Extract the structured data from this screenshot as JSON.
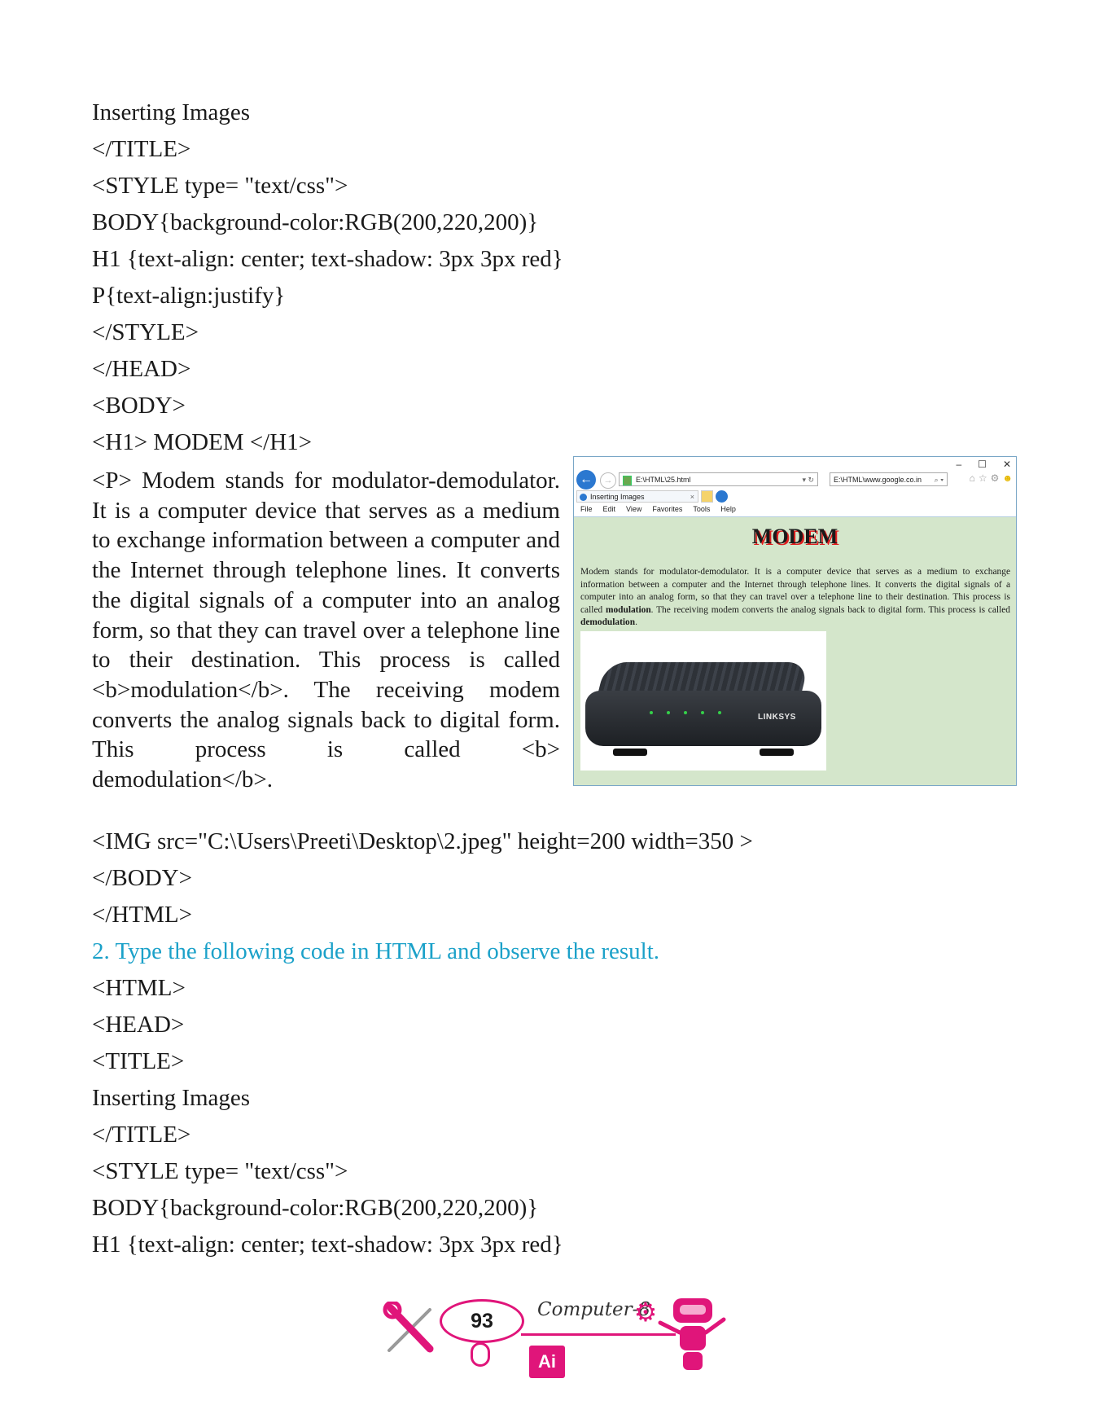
{
  "code_top": [
    "Inserting Images",
    "</TITLE>",
    "<STYLE type= \"text/css\">",
    "BODY{background-color:RGB(200,220,200)}",
    "H1 {text-align: center; text-shadow: 3px 3px red}",
    "P{text-align:justify}",
    "</STYLE>",
    "</HEAD>",
    "<BODY>",
    "<H1> MODEM </H1>"
  ],
  "code_paragraph": "<P> Modem stands for modulator-demodulator. It is a computer device that serves as a medium to exchange information between a computer and the Internet through telephone lines. It converts the digital signals of a computer into an analog form, so that they can travel over a telephone line to their destination. This process is called <b>modulation</b>. The receiving modem converts the analog signals back to digital form. This process is called <b>",
  "code_paragraph_end": "demodulation</b>.",
  "code_bottom": [
    "<IMG src=\"C:\\Users\\Preeti\\Desktop\\2.jpeg\" height=200 width=350 >",
    "</BODY>",
    "</HTML>"
  ],
  "exercise_heading": "2. Type the following code in HTML and observe the result.",
  "code_second": [
    "<HTML>",
    "<HEAD>",
    "<TITLE>",
    "Inserting Images",
    "</TITLE>",
    "<STYLE type= \"text/css\">",
    "BODY{background-color:RGB(200,220,200)}",
    "H1 {text-align: center; text-shadow: 3px 3px red}"
  ],
  "browser": {
    "window_controls": [
      "–",
      "☐",
      "✕"
    ],
    "address": "E:\\HTML\\25.html",
    "address_controls": "▾ ↻",
    "search_box": "E:\\HTML\\www.google.co.in",
    "search_controls": "⌕ ▾",
    "tab_title": "Inserting Images",
    "tab_close": "×",
    "menu": [
      "File",
      "Edit",
      "View",
      "Favorites",
      "Tools",
      "Help"
    ],
    "page_heading": "MODEM",
    "page_paragraph_start": "Modem stands for modulator-demodulator. It is a computer device that serves as a medium to exchange information between a computer and the Internet through telephone lines. It converts the digital signals of a computer into an analog form, so that they can travel over a telephone line to their destination. This process is called ",
    "page_bold_1": "modulation",
    "page_paragraph_mid": ". The receiving modem converts the analog signals back to digital form. This process is called ",
    "page_bold_2": "demodulation",
    "page_paragraph_end": ".",
    "modem_brand": "LINKSYS"
  },
  "footer": {
    "page_number": "93",
    "subject": "Computer-8",
    "badge": "Ai"
  },
  "colors": {
    "heading_blue": "#1ba1c9",
    "footer_pink": "#e0157a",
    "browser_page_bg": "#d4e6cb"
  }
}
